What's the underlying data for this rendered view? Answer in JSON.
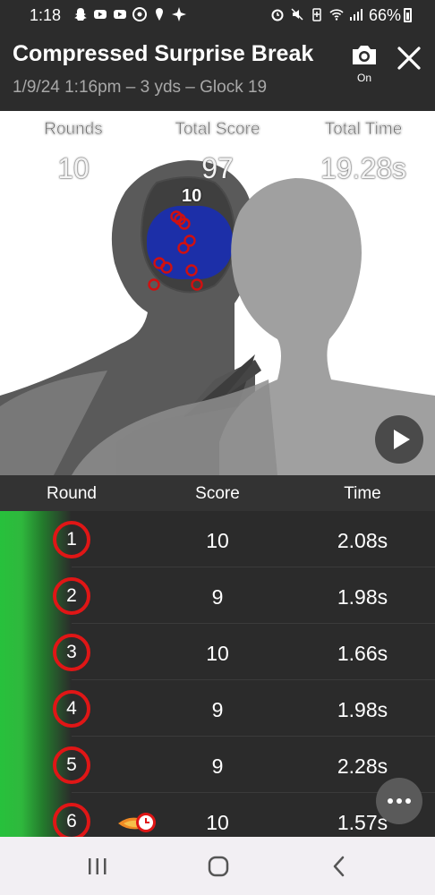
{
  "status_bar": {
    "time": "1:18",
    "battery": "66%"
  },
  "header": {
    "title": "Compressed Surprise Break",
    "subtitle": "1/9/24 1:16pm – 3 yds – Glock 19",
    "camera_label": "On"
  },
  "stats": {
    "rounds_label": "Rounds",
    "rounds_value": "10",
    "total_score_label": "Total Score",
    "total_score_value": "97",
    "total_time_label": "Total Time",
    "total_time_value": "19.28s"
  },
  "target": {
    "zone_label": "10",
    "zone_color": "#1c2fa8",
    "hit_color": "#d01010",
    "hits_count": 10
  },
  "table": {
    "headers": {
      "round": "Round",
      "score": "Score",
      "time": "Time"
    },
    "rows": [
      {
        "round": "1",
        "score": "10",
        "time": "2.08s"
      },
      {
        "round": "2",
        "score": "9",
        "time": "1.98s"
      },
      {
        "round": "3",
        "score": "10",
        "time": "1.66s"
      },
      {
        "round": "4",
        "score": "9",
        "time": "1.98s"
      },
      {
        "round": "5",
        "score": "9",
        "time": "2.28s"
      },
      {
        "round": "6",
        "score": "10",
        "time": "1.57s",
        "badge": "fastest-timer-icon"
      }
    ]
  },
  "colors": {
    "accent_green": "#27c13c",
    "round_ring": "#e01616",
    "background": "#2b2b2b"
  }
}
